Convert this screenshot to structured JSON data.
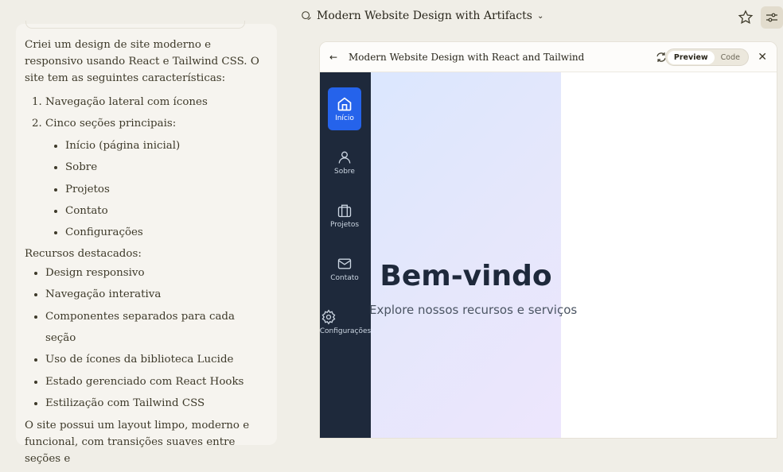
{
  "header": {
    "title": "Modern Website Design with Artifacts"
  },
  "chat": {
    "intro": "Criei um design de site moderno e responsivo usando React e Tailwind CSS. O site tem as seguintes características:",
    "ordered": [
      "Navegação lateral com ícones",
      "Cinco seções principais:"
    ],
    "sections": [
      "Início (página inicial)",
      "Sobre",
      "Projetos",
      "Contato",
      "Configurações"
    ],
    "features_heading": "Recursos destacados:",
    "features": [
      "Design responsivo",
      "Navegação interativa",
      "Componentes separados para cada seção",
      "Uso de ícones da biblioteca Lucide",
      "Estado gerenciado com React Hooks",
      "Estilização com Tailwind CSS"
    ],
    "outro": "O site possui um layout limpo, moderno e funcional, com transições suaves entre seções e"
  },
  "artifact": {
    "title": "Modern Website Design with React and Tailwind",
    "preview_label": "Preview",
    "code_label": "Code",
    "nav": [
      "Início",
      "Sobre",
      "Projetos",
      "Contato",
      "Configurações"
    ],
    "hero_title": "Bem-vindo",
    "hero_subtitle": "Explore nossos recursos e serviços"
  }
}
